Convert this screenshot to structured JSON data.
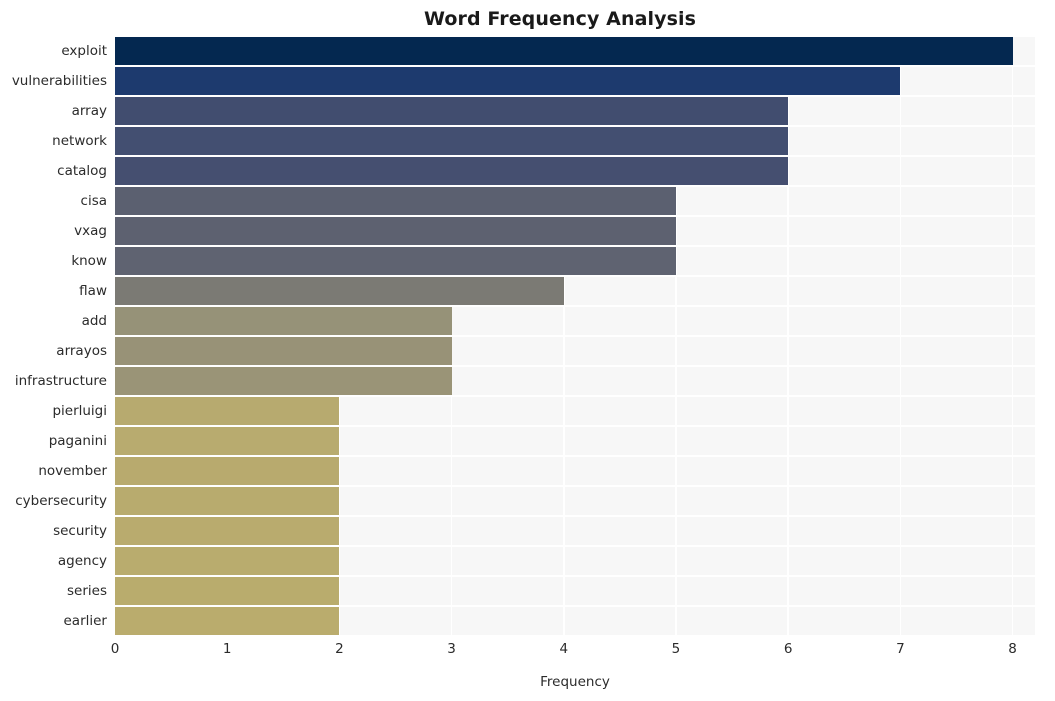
{
  "chart_data": {
    "type": "bar",
    "orientation": "horizontal",
    "title": "Word Frequency Analysis",
    "xlabel": "Frequency",
    "ylabel": "",
    "xlim": [
      0,
      8.2
    ],
    "xticks": [
      "0",
      "1",
      "2",
      "3",
      "4",
      "5",
      "6",
      "7",
      "8"
    ],
    "xtick_values": [
      0,
      1,
      2,
      3,
      4,
      5,
      6,
      7,
      8
    ],
    "grid": true,
    "legend": "none",
    "categories": [
      "exploit",
      "vulnerabilities",
      "array",
      "network",
      "catalog",
      "cisa",
      "vxag",
      "know",
      "flaw",
      "add",
      "arrayos",
      "infrastructure",
      "pierluigi",
      "paganini",
      "november",
      "cybersecurity",
      "security",
      "agency",
      "series",
      "earlier"
    ],
    "values": [
      8,
      7,
      6,
      6,
      6,
      5,
      5,
      5,
      4,
      3,
      3,
      3,
      2,
      2,
      2,
      2,
      2,
      2,
      2,
      2
    ],
    "bar_colors": [
      "#042850",
      "#1d3a6e",
      "#414d6f",
      "#434f71",
      "#454f70",
      "#5b6070",
      "#5d6170",
      "#5f6371",
      "#7b7a74",
      "#969278",
      "#989277",
      "#9a9477",
      "#b7aa6f",
      "#b8ab6f",
      "#b8aa6e",
      "#b8ab6e",
      "#b9ab6e",
      "#b9ac6e",
      "#b9ac6d",
      "#baac6d"
    ],
    "plot_background": "#f7f7f7",
    "grid_color": "#ffffff",
    "figure_background": "#ffffff",
    "text_color": "#2b2b2b"
  }
}
